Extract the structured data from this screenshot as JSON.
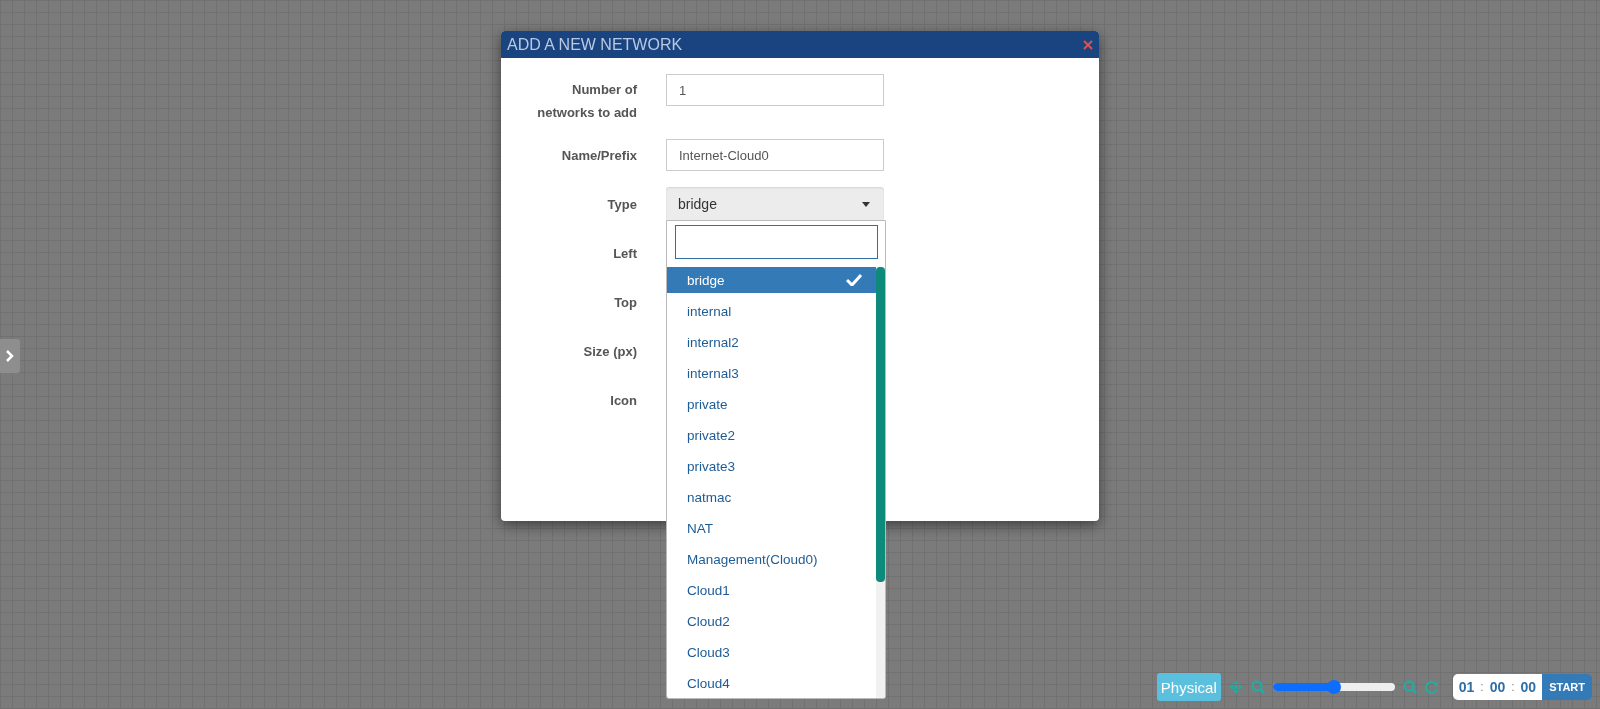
{
  "dialog": {
    "title": "ADD A NEW NETWORK",
    "fields": [
      {
        "kind": "input",
        "label": "Number of networks to add",
        "value": "1"
      },
      {
        "kind": "input",
        "label": "Name/Prefix",
        "value": "Internet-Cloud0"
      },
      {
        "kind": "select",
        "label": "Type",
        "value": "bridge",
        "expanded": true
      },
      {
        "kind": "covered",
        "label": "Left"
      },
      {
        "kind": "covered",
        "label": "Top"
      },
      {
        "kind": "covered",
        "label": "Size (px)"
      },
      {
        "kind": "covered",
        "label": "Icon"
      }
    ],
    "type_options": [
      {
        "label": "bridge",
        "selected": true
      },
      {
        "label": "internal",
        "selected": false
      },
      {
        "label": "internal2",
        "selected": false
      },
      {
        "label": "internal3",
        "selected": false
      },
      {
        "label": "private",
        "selected": false
      },
      {
        "label": "private2",
        "selected": false
      },
      {
        "label": "private3",
        "selected": false
      },
      {
        "label": "natmac",
        "selected": false
      },
      {
        "label": "NAT",
        "selected": false
      },
      {
        "label": "Management(Cloud0)",
        "selected": false
      },
      {
        "label": "Cloud1",
        "selected": false
      },
      {
        "label": "Cloud2",
        "selected": false
      },
      {
        "label": "Cloud3",
        "selected": false
      },
      {
        "label": "Cloud4",
        "selected": false
      }
    ]
  },
  "toolbar": {
    "mode_button": "Physical",
    "zoom": {
      "level": 0.5
    },
    "timer": {
      "parts": [
        "01",
        "00",
        "00"
      ],
      "separators": [
        ":",
        ":"
      ]
    },
    "start_button": "START"
  }
}
